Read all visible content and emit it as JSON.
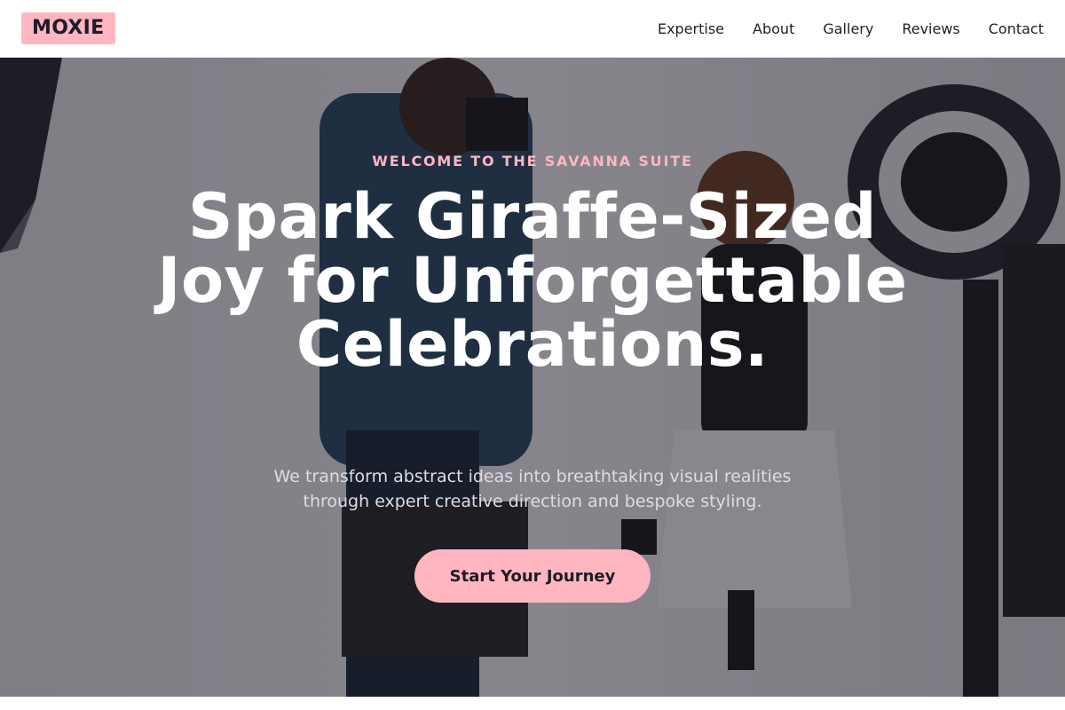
{
  "header": {
    "logo": "MOXIE",
    "nav": [
      "Expertise",
      "About",
      "Gallery",
      "Reviews",
      "Contact"
    ]
  },
  "hero": {
    "eyebrow": "WELCOME TO THE SAVANNA SUITE",
    "headline": "Spark Giraffe-Sized Joy for Unforgettable Celebrations.",
    "subtext": "We transform abstract ideas into breathtaking visual realities through expert creative direction and bespoke styling.",
    "cta_label": "Start Your Journey"
  },
  "colors": {
    "accent": "#ffb6c1",
    "text_dark": "#1c1c28",
    "overlay": "#12101c"
  }
}
